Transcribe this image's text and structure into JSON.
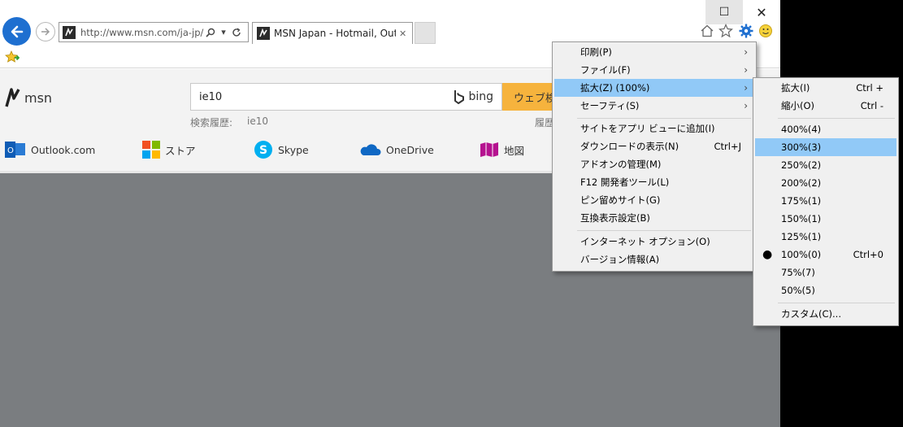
{
  "browser": {
    "address_url": "http://www.msn.com/ja-jp/",
    "tab_title": "MSN Japan - Hotmail, Outl...",
    "window_controls": {
      "maximize": "☐",
      "close": "✕"
    }
  },
  "page": {
    "brand": "msn",
    "search_value": "ie10",
    "search_engine": "bing",
    "search_button_label": "ウェブ検索",
    "history_label": "検索履歴:",
    "history_value": "ie10",
    "history_label_right": "履歴",
    "services": [
      {
        "label": "Outlook.com",
        "icon": "outlook-icon"
      },
      {
        "label": "ストア",
        "icon": "store-icon"
      },
      {
        "label": "Skype",
        "icon": "skype-icon"
      },
      {
        "label": "OneDrive",
        "icon": "onedrive-icon"
      },
      {
        "label": "地図",
        "icon": "maps-icon"
      }
    ]
  },
  "tools_menu": {
    "items": [
      {
        "label": "印刷(P)",
        "submenu": true
      },
      {
        "label": "ファイル(F)",
        "submenu": true
      },
      {
        "label": "拡大(Z) (100%)",
        "submenu": true,
        "highlighted": true
      },
      {
        "label": "セーフティ(S)",
        "submenu": true
      },
      {
        "label": "サイトをアプリ ビューに追加(I)"
      },
      {
        "label": "ダウンロードの表示(N)",
        "shortcut": "Ctrl+J"
      },
      {
        "label": "アドオンの管理(M)"
      },
      {
        "label": "F12 開発者ツール(L)"
      },
      {
        "label": "ピン留めサイト(G)"
      },
      {
        "label": "互換表示設定(B)"
      },
      {
        "label": "インターネット オプション(O)"
      },
      {
        "label": "バージョン情報(A)"
      }
    ]
  },
  "zoom_menu": {
    "items": [
      {
        "label": "拡大(I)",
        "shortcut": "Ctrl +"
      },
      {
        "label": "縮小(O)",
        "shortcut": "Ctrl -"
      },
      {
        "label": "400%(4)"
      },
      {
        "label": "300%(3)",
        "highlighted": true
      },
      {
        "label": "250%(2)"
      },
      {
        "label": "200%(2)"
      },
      {
        "label": "175%(1)"
      },
      {
        "label": "150%(1)"
      },
      {
        "label": "125%(1)"
      },
      {
        "label": "100%(0)",
        "shortcut": "Ctrl+0",
        "checked": true
      },
      {
        "label": "75%(7)"
      },
      {
        "label": "50%(5)"
      },
      {
        "label": "カスタム(C)..."
      }
    ]
  },
  "colors": {
    "accent_blue": "#1e6fd0",
    "menu_highlight": "#91c9f7",
    "search_button": "#f6b33d",
    "page_background": "#7a7d80"
  }
}
